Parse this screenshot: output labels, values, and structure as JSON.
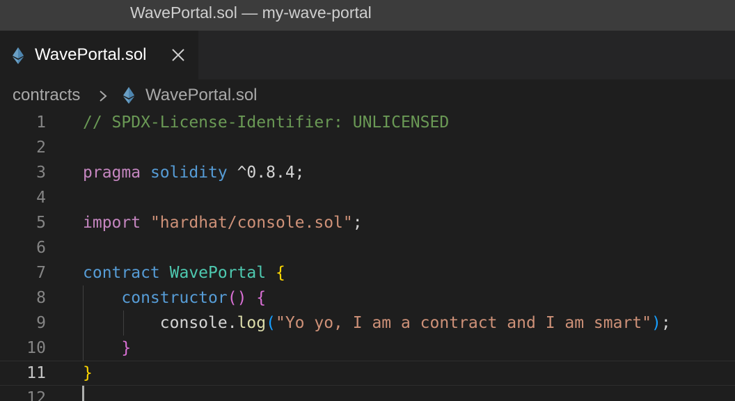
{
  "window": {
    "title": "WavePortal.sol — my-wave-portal"
  },
  "tabs": [
    {
      "label": "WavePortal.sol",
      "icon": "ethereum-icon",
      "active": true
    }
  ],
  "breadcrumb": {
    "folder": "contracts",
    "file": "WavePortal.sol"
  },
  "editor": {
    "colors": {
      "comment": "#6a9955",
      "keyword": "#c586c0",
      "storage": "#569cd6",
      "string": "#ce9178",
      "type": "#4ec9b0",
      "function": "#dcdcaa"
    },
    "lines": [
      {
        "n": "1",
        "tokens": [
          {
            "t": "// SPDX-License-Identifier: UNLICENSED",
            "c": "comment"
          }
        ]
      },
      {
        "n": "2",
        "tokens": []
      },
      {
        "n": "3",
        "tokens": [
          {
            "t": "pragma",
            "c": "keyword"
          },
          {
            "t": " ",
            "c": "plain"
          },
          {
            "t": "solidity",
            "c": "storage"
          },
          {
            "t": " ^0.8.4;",
            "c": "plain"
          }
        ]
      },
      {
        "n": "4",
        "tokens": []
      },
      {
        "n": "5",
        "tokens": [
          {
            "t": "import",
            "c": "keyword"
          },
          {
            "t": " ",
            "c": "plain"
          },
          {
            "t": "\"hardhat/console.sol\"",
            "c": "string"
          },
          {
            "t": ";",
            "c": "plain"
          }
        ]
      },
      {
        "n": "6",
        "tokens": []
      },
      {
        "n": "7",
        "tokens": [
          {
            "t": "contract",
            "c": "storage"
          },
          {
            "t": " ",
            "c": "plain"
          },
          {
            "t": "WavePortal",
            "c": "type"
          },
          {
            "t": " ",
            "c": "plain"
          },
          {
            "t": "{",
            "c": "b1"
          }
        ]
      },
      {
        "n": "8",
        "tokens": [
          {
            "t": "    ",
            "c": "plain"
          },
          {
            "t": "constructor",
            "c": "storage"
          },
          {
            "t": "()",
            "c": "b2"
          },
          {
            "t": " ",
            "c": "plain"
          },
          {
            "t": "{",
            "c": "b2"
          }
        ]
      },
      {
        "n": "9",
        "tokens": [
          {
            "t": "        console.",
            "c": "plain"
          },
          {
            "t": "log",
            "c": "func"
          },
          {
            "t": "(",
            "c": "b3"
          },
          {
            "t": "\"Yo yo, I am a contract and I am smart\"",
            "c": "string"
          },
          {
            "t": ")",
            "c": "b3"
          },
          {
            "t": ";",
            "c": "plain"
          }
        ]
      },
      {
        "n": "10",
        "tokens": [
          {
            "t": "    ",
            "c": "plain"
          },
          {
            "t": "}",
            "c": "b2"
          }
        ]
      },
      {
        "n": "11",
        "tokens": [
          {
            "t": "}",
            "c": "b1"
          }
        ]
      },
      {
        "n": "12",
        "tokens": []
      }
    ]
  }
}
